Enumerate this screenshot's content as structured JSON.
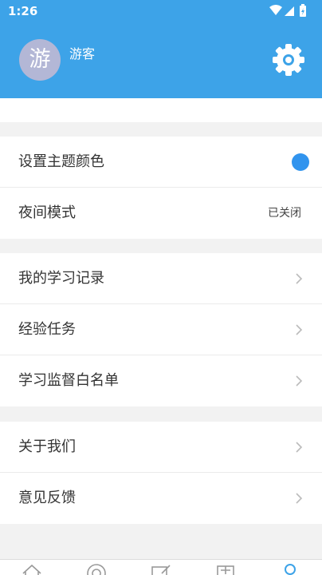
{
  "status_bar": {
    "time": "1:26"
  },
  "profile": {
    "avatar_text": "游",
    "username": "游客"
  },
  "colors": {
    "primary": "#3da3e8",
    "theme_dot": "#3194ee",
    "avatar_bg": "#b3b7d6"
  },
  "settings_group": {
    "theme_color_label": "设置主题颜色",
    "night_mode_label": "夜间模式",
    "night_mode_value": "已关闭"
  },
  "study_group": {
    "items": [
      {
        "label": "我的学习记录"
      },
      {
        "label": "经验任务"
      },
      {
        "label": "学习监督白名单"
      }
    ]
  },
  "about_group": {
    "items": [
      {
        "label": "关于我们"
      },
      {
        "label": "意见反馈"
      }
    ]
  },
  "bottom_nav": {
    "icons": [
      "home-icon",
      "compass-icon",
      "edit-icon",
      "document-icon",
      "profile-icon"
    ]
  }
}
